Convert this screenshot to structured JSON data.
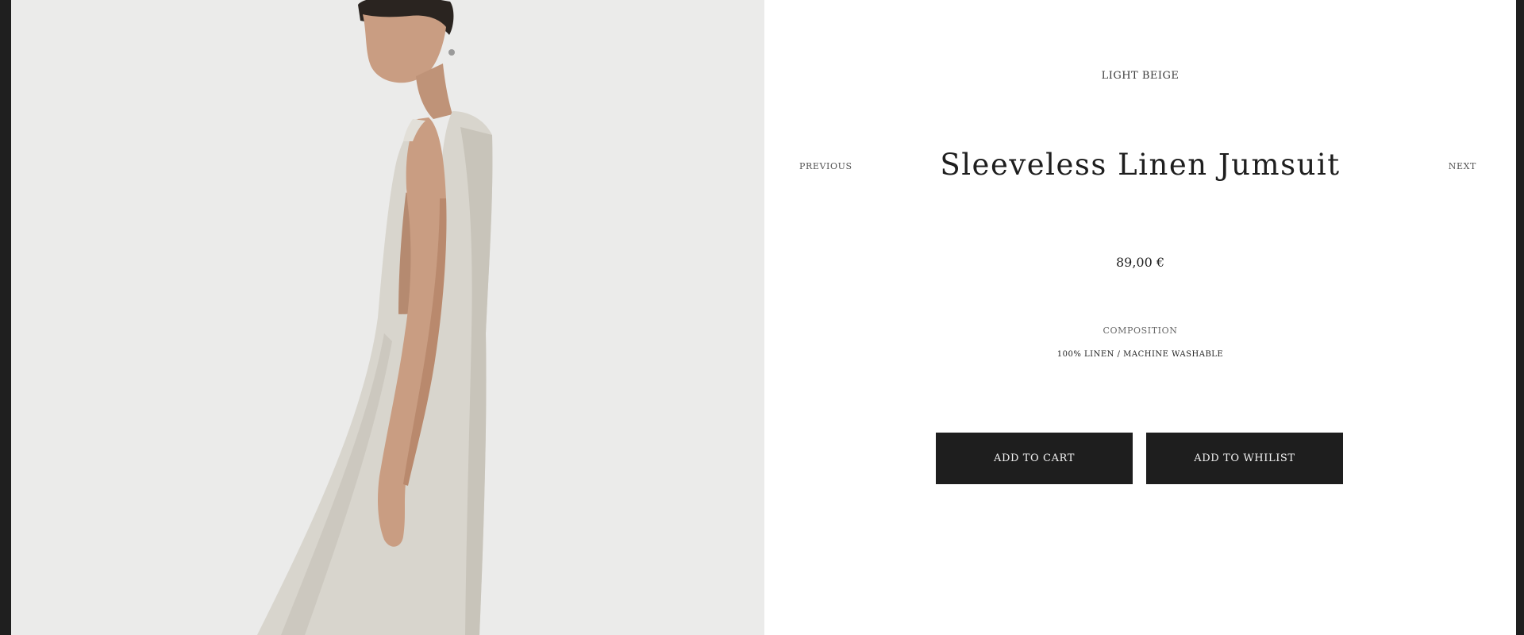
{
  "product": {
    "color": "LIGHT BEIGE",
    "title": "Sleeveless Linen Jumsuit",
    "price": "89,00 €",
    "composition_label": "COMPOSITION",
    "composition_value": "100% LINEN / MACHINE WASHABLE"
  },
  "navigation": {
    "previous": "PREVIOUS",
    "next": "NEXT"
  },
  "actions": {
    "add_to_cart": "ADD TO CART",
    "add_to_wishlist": "ADD TO WHILIST"
  },
  "colors": {
    "frame": "#1f1f1f",
    "image_background": "#ebebea",
    "button": "#1e1e1e",
    "garment": "#d8d5cd",
    "skin": "#c99d82"
  }
}
